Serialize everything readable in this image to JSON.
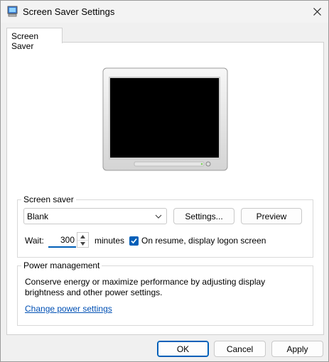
{
  "window": {
    "title": "Screen Saver Settings",
    "close_glyph": "✕"
  },
  "tabs": [
    {
      "label": "Screen Saver"
    }
  ],
  "screen_saver": {
    "group_label": "Screen saver",
    "selected": "Blank",
    "settings_label": "Settings...",
    "preview_label": "Preview",
    "wait_label": "Wait:",
    "wait_value": "300",
    "minutes_label": "minutes",
    "resume_checked": true,
    "resume_label": "On resume, display logon screen"
  },
  "power": {
    "group_label": "Power management",
    "description": "Conserve energy or maximize performance by adjusting display brightness and other power settings.",
    "link_label": "Change power settings"
  },
  "footer": {
    "ok_label": "OK",
    "cancel_label": "Cancel",
    "apply_label": "Apply"
  },
  "colors": {
    "accent": "#005fb8",
    "link": "#0050b4",
    "panel_bg": "#ffffff",
    "window_bg": "#f0f0f0"
  },
  "icons": [
    "screen-saver-app-icon",
    "close-icon",
    "chevron-down-icon",
    "spin-up-icon",
    "spin-down-icon",
    "checkmark-icon",
    "monitor-preview-icon"
  ]
}
